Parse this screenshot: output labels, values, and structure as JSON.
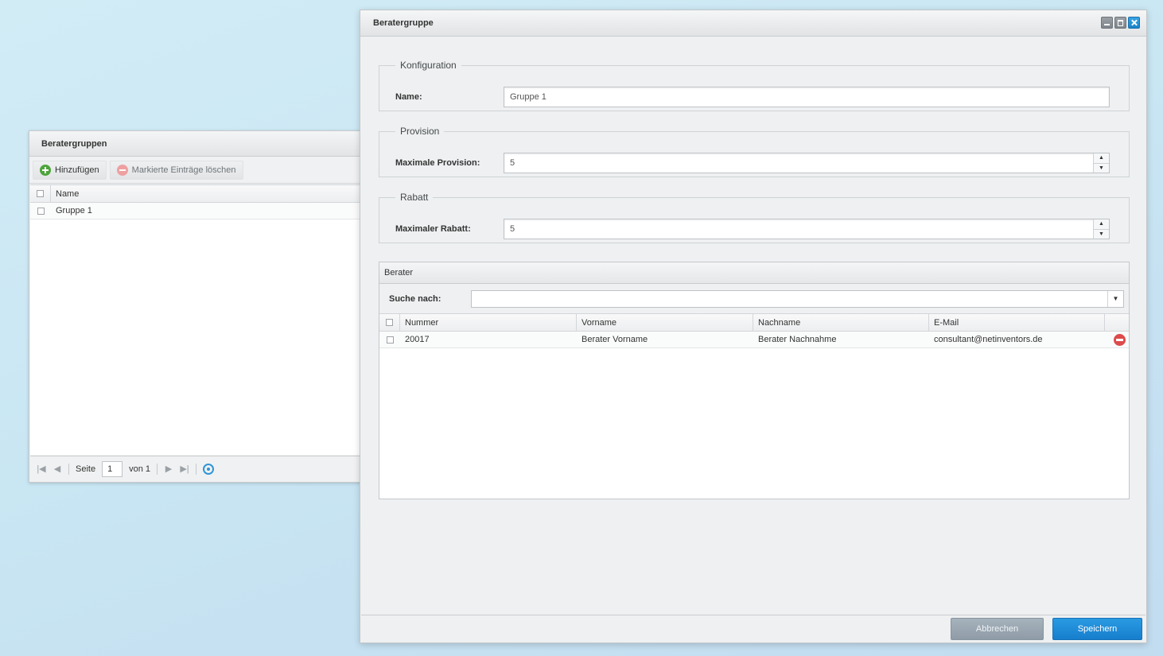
{
  "left_window": {
    "title": "Beratergruppen",
    "toolbar": {
      "add_label": "Hinzufügen",
      "delete_label": "Markierte Einträge löschen"
    },
    "grid": {
      "header_name": "Name",
      "rows": [
        {
          "name": "Gruppe 1"
        }
      ]
    },
    "pager": {
      "page_label": "Seite",
      "page_value": "1",
      "of_label": "von 1"
    }
  },
  "main_window": {
    "title": "Beratergruppe",
    "konfiguration": {
      "legend": "Konfiguration",
      "name_label": "Name:",
      "name_value": "Gruppe 1"
    },
    "provision": {
      "legend": "Provision",
      "label": "Maximale Provision:",
      "value": "5"
    },
    "rabatt": {
      "legend": "Rabatt",
      "label": "Maximaler Rabatt:",
      "value": "5"
    },
    "berater": {
      "title": "Berater",
      "search_label": "Suche nach:",
      "search_value": "",
      "columns": {
        "nummer": "Nummer",
        "vorname": "Vorname",
        "nachname": "Nachname",
        "email": "E-Mail"
      },
      "rows": [
        {
          "nummer": "20017",
          "vorname": "Berater Vorname",
          "nachname": "Berater Nachnahme",
          "email": "consultant@netinventors.de"
        }
      ]
    },
    "buttons": {
      "cancel": "Abbrechen",
      "save": "Speichern"
    }
  },
  "colors": {
    "accent": "#1a82c7",
    "add": "#4ea43b",
    "delete": "#dd4b4b"
  },
  "icons": {
    "add": "plus-circle-icon",
    "delete": "minus-circle-icon",
    "refresh": "refresh-icon",
    "minimize": "minimize-icon",
    "maximize": "maximize-icon",
    "close": "close-icon"
  }
}
